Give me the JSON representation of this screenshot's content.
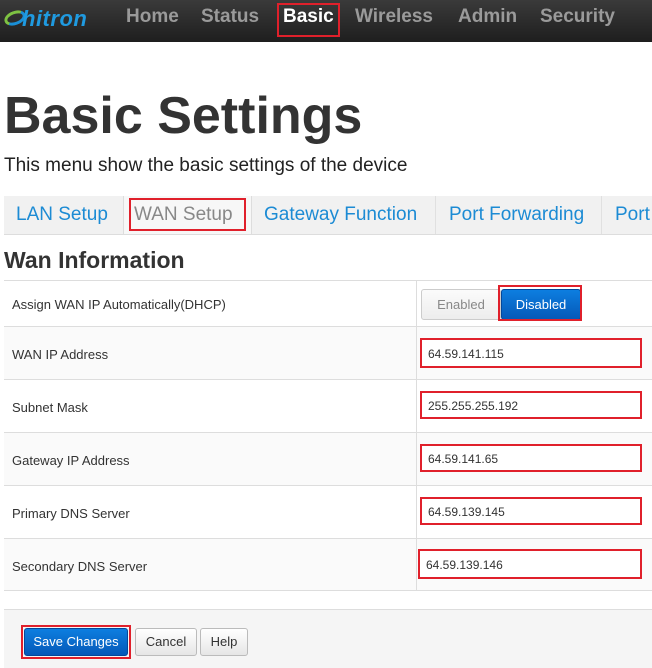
{
  "header": {
    "logo_text": "hitron",
    "nav": [
      "Home",
      "Status",
      "Basic",
      "Wireless",
      "Admin",
      "Security"
    ],
    "active_nav": "Basic"
  },
  "page": {
    "title": "Basic Settings",
    "subtitle": "This menu show the basic settings of the device"
  },
  "tabs": [
    "LAN Setup",
    "WAN Setup",
    "Gateway Function",
    "Port Forwarding",
    "Port"
  ],
  "active_tab": "WAN Setup",
  "section": {
    "title": "Wan Information",
    "dhcp": {
      "label": "Assign WAN IP Automatically(DHCP)",
      "enabled_label": "Enabled",
      "disabled_label": "Disabled",
      "selected": "Disabled"
    },
    "fields": [
      {
        "label": "WAN IP Address",
        "value": "64.59.141.115"
      },
      {
        "label": "Subnet Mask",
        "value": "255.255.255.192"
      },
      {
        "label": "Gateway IP Address",
        "value": "64.59.141.65"
      },
      {
        "label": "Primary DNS Server",
        "value": "64.59.139.145"
      },
      {
        "label": "Secondary DNS Server",
        "value": "64.59.139.146"
      }
    ]
  },
  "actions": {
    "save": "Save Changes",
    "cancel": "Cancel",
    "help": "Help"
  },
  "colors": {
    "highlight": "#e0202b",
    "link": "#1c8bd4",
    "primary": "#0559b8"
  }
}
